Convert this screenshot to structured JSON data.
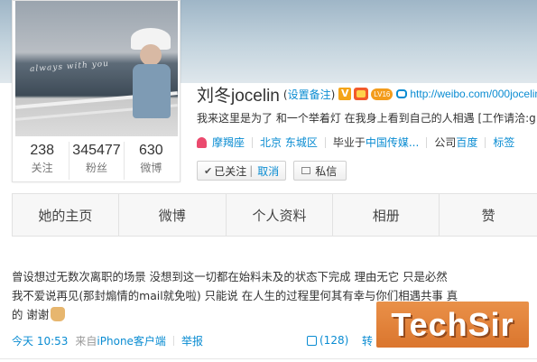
{
  "profile": {
    "avatar_caption": "always with you",
    "name": "刘冬jocelin",
    "beian_open": "(",
    "beian_link": "设置备注",
    "beian_close": ")",
    "v_badge": "V",
    "level": "LV16",
    "url": "http://weibo.com/000jocelin",
    "description": "我来这里是为了 和一个举着灯 在我身上看到自己的人相遇 [工作请洽:g",
    "stats": [
      {
        "value": "238",
        "label": "关注"
      },
      {
        "value": "345477",
        "label": "粉丝"
      },
      {
        "value": "630",
        "label": "微博"
      }
    ],
    "tags": {
      "zodiac": "摩羯座",
      "location": "北京 东城区",
      "school_prefix": "毕业于",
      "school": "中国传媒...",
      "company_prefix": "公司",
      "company": "百度",
      "tags_label": "标签"
    },
    "actions": {
      "followed": "已关注",
      "divider": "|",
      "cancel": "取消",
      "message": "私信"
    }
  },
  "tabs": [
    "她的主页",
    "微博",
    "个人资料",
    "相册",
    "赞"
  ],
  "post": {
    "line1": "曾设想过无数次离职的场景 没想到这一切都在始料未及的状态下完成 理由无它 只是必然",
    "line2": "我不爱说再见(那封煽情的mail就免啦) 只能说 在人生的过程里何其有幸与你们相遇共事 真",
    "line3": "的 谢谢",
    "time": "今天 10:53",
    "source_prefix": "来自",
    "source": "iPhone客户端",
    "report": "举报",
    "likes": "(128)",
    "forward": "转"
  },
  "watermark": "TechSir",
  "colors": {
    "link": "#0a8cd2",
    "watermark": "#e8883a"
  }
}
